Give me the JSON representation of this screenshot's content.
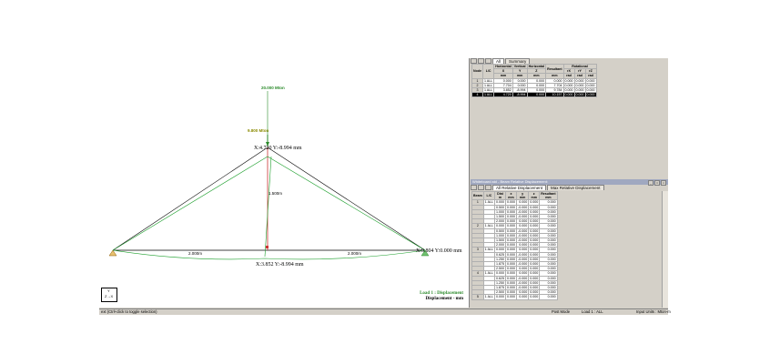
{
  "viewport": {
    "loads": [
      {
        "label": "20.000 Mton"
      },
      {
        "label": "9.800 Mton"
      }
    ],
    "node_labels": {
      "top": "X:4.720 Y:-8.994 mm",
      "right": "X:9.804 Y:0.000 mm",
      "bottom": "X:3.852 Y:-8.994 mm"
    },
    "dimensions": {
      "vertical": "1.500m",
      "left_span": "2.000m",
      "right_span": "2.000m"
    },
    "legend": {
      "title": "Load 1 : Displacement",
      "subtitle": "Displacement - mm"
    },
    "axis": {
      "y": "Y",
      "x": "Z→X"
    },
    "colors": {
      "structure": "#000000",
      "deflected": "#1a9e2a",
      "load": "#2a8a2a",
      "member": "#cc3333",
      "legend": "#2a8a2a"
    }
  },
  "top_panel": {
    "tabs": [
      "All",
      "Summary"
    ],
    "header_groups": [
      "Horizontal",
      "Vertical",
      "Horizontal",
      "Resultant",
      "Rotational"
    ],
    "columns": [
      {
        "name": "Node",
        "unit": ""
      },
      {
        "name": "L/C",
        "unit": ""
      },
      {
        "name": "X",
        "unit": "mm"
      },
      {
        "name": "Y",
        "unit": "mm"
      },
      {
        "name": "Z",
        "unit": "mm"
      },
      {
        "name": "",
        "unit": "mm"
      },
      {
        "name": "rX",
        "unit": "rad"
      },
      {
        "name": "rY",
        "unit": "rad"
      },
      {
        "name": "rZ",
        "unit": "rad"
      }
    ],
    "rows": [
      {
        "node": "1",
        "lc": "1 ALL",
        "vals": [
          "0.000",
          "0.000",
          "0.000",
          "0.000",
          "0.000",
          "0.000",
          "0.000"
        ]
      },
      {
        "node": "2",
        "lc": "1 ALL",
        "vals": [
          "7.704",
          "0.000",
          "0.000",
          "7.704",
          "0.000",
          "0.000",
          "0.000"
        ]
      },
      {
        "node": "3",
        "lc": "1 ALL",
        "vals": [
          "3.852",
          "-8.994",
          "0.000",
          "9.784",
          "0.000",
          "0.000",
          "0.000"
        ]
      },
      {
        "node": "4",
        "lc": "1 ALL",
        "vals": [
          "4.720",
          "-8.994",
          "0.000",
          "10.157",
          "0.000",
          "0.000",
          "0.000"
        ],
        "selected": true
      }
    ]
  },
  "bottom_panel": {
    "title": "Whiteboard.std - Beam Relative Displacement:",
    "tabs": [
      "All Relative Displacement",
      "Max Relative Displacement"
    ],
    "columns": [
      {
        "name": "Beam",
        "unit": ""
      },
      {
        "name": "L/C",
        "unit": ""
      },
      {
        "name": "Dist",
        "unit": "m"
      },
      {
        "name": "x",
        "unit": "mm"
      },
      {
        "name": "y",
        "unit": "mm"
      },
      {
        "name": "z",
        "unit": "mm"
      },
      {
        "name": "Resultant",
        "unit": "mm"
      }
    ],
    "rows": [
      {
        "beam": "1",
        "lc": "1 ALL",
        "vals": [
          "0.000",
          "0.000",
          "0.000",
          "0.000",
          "0.000"
        ]
      },
      {
        "beam": "",
        "lc": "",
        "vals": [
          "0.500",
          "0.000",
          "-0.000",
          "0.000",
          "0.000"
        ]
      },
      {
        "beam": "",
        "lc": "",
        "vals": [
          "1.000",
          "0.000",
          "-0.000",
          "0.000",
          "0.000"
        ]
      },
      {
        "beam": "",
        "lc": "",
        "vals": [
          "1.500",
          "0.000",
          "-0.000",
          "0.000",
          "0.000"
        ]
      },
      {
        "beam": "",
        "lc": "",
        "vals": [
          "2.000",
          "0.000",
          "0.000",
          "0.000",
          "0.000"
        ]
      },
      {
        "beam": "2",
        "lc": "1 ALL",
        "vals": [
          "0.000",
          "0.000",
          "0.000",
          "0.000",
          "0.000"
        ]
      },
      {
        "beam": "",
        "lc": "",
        "vals": [
          "0.500",
          "0.000",
          "-0.000",
          "0.000",
          "0.000"
        ]
      },
      {
        "beam": "",
        "lc": "",
        "vals": [
          "1.000",
          "0.000",
          "-0.000",
          "0.000",
          "0.000"
        ]
      },
      {
        "beam": "",
        "lc": "",
        "vals": [
          "1.500",
          "0.000",
          "-0.000",
          "0.000",
          "0.000"
        ]
      },
      {
        "beam": "",
        "lc": "",
        "vals": [
          "2.000",
          "0.000",
          "0.000",
          "0.000",
          "0.000"
        ]
      },
      {
        "beam": "3",
        "lc": "1 ALL",
        "vals": [
          "0.000",
          "0.000",
          "0.000",
          "0.000",
          "0.000"
        ]
      },
      {
        "beam": "",
        "lc": "",
        "vals": [
          "0.625",
          "0.000",
          "-0.000",
          "0.000",
          "0.000"
        ]
      },
      {
        "beam": "",
        "lc": "",
        "vals": [
          "1.250",
          "0.000",
          "-0.000",
          "0.000",
          "0.000"
        ]
      },
      {
        "beam": "",
        "lc": "",
        "vals": [
          "1.875",
          "0.000",
          "-0.000",
          "0.000",
          "0.000"
        ]
      },
      {
        "beam": "",
        "lc": "",
        "vals": [
          "2.500",
          "0.000",
          "0.000",
          "0.000",
          "0.000"
        ]
      },
      {
        "beam": "4",
        "lc": "1 ALL",
        "vals": [
          "0.000",
          "0.000",
          "0.000",
          "0.000",
          "0.000"
        ]
      },
      {
        "beam": "",
        "lc": "",
        "vals": [
          "0.625",
          "0.000",
          "-0.000",
          "0.000",
          "0.000"
        ]
      },
      {
        "beam": "",
        "lc": "",
        "vals": [
          "1.250",
          "0.000",
          "-0.000",
          "0.000",
          "0.000"
        ]
      },
      {
        "beam": "",
        "lc": "",
        "vals": [
          "1.875",
          "0.000",
          "-0.000",
          "0.000",
          "0.000"
        ]
      },
      {
        "beam": "",
        "lc": "",
        "vals": [
          "2.500",
          "0.000",
          "0.000",
          "0.000",
          "0.000"
        ]
      },
      {
        "beam": "5",
        "lc": "1 ALL",
        "vals": [
          "0.000",
          "0.000",
          "0.000",
          "0.000",
          "0.000"
        ]
      }
    ]
  },
  "statusbar": {
    "left": "ext (Ctrl+click to toggle selection)",
    "mode": "Post Mode",
    "load": "Load 1 : ALL",
    "units": "Input Units : Mton-m"
  }
}
